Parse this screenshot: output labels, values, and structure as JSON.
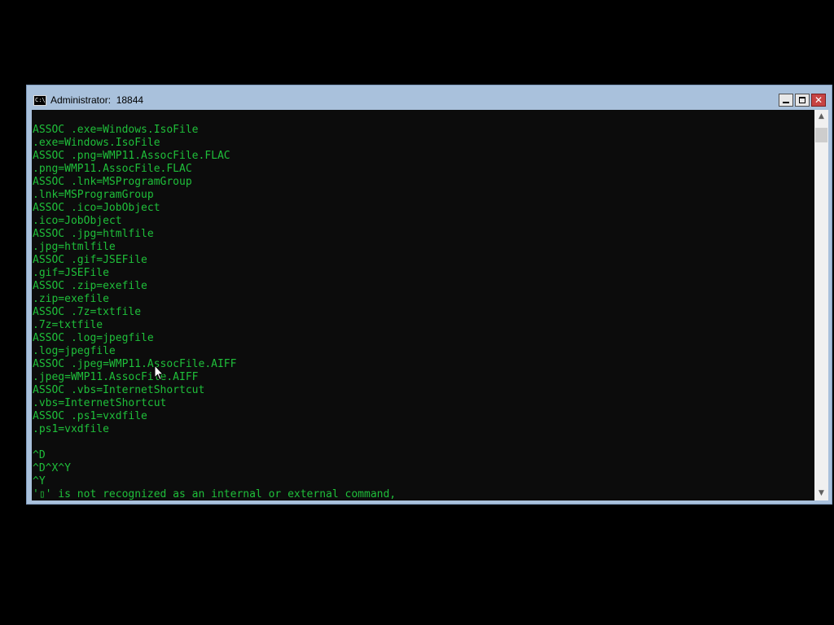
{
  "window": {
    "title": "Administrator:  18844",
    "icon": "cmd-app-icon",
    "icon_text": "C:\\"
  },
  "controls": {
    "minimize": "minimize-icon",
    "maximize": "maximize-icon",
    "close": "close-icon",
    "close_glyph": "✕"
  },
  "console": {
    "text_color": "#1fbf3a",
    "background": "#0c0c0c",
    "lines": [
      "ASSOC .exe=Windows.IsoFile",
      ".exe=Windows.IsoFile",
      "ASSOC .png=WMP11.AssocFile.FLAC",
      ".png=WMP11.AssocFile.FLAC",
      "ASSOC .lnk=MSProgramGroup",
      ".lnk=MSProgramGroup",
      "ASSOC .ico=JobObject",
      ".ico=JobObject",
      "ASSOC .jpg=htmlfile",
      ".jpg=htmlfile",
      "ASSOC .gif=JSEFile",
      ".gif=JSEFile",
      "ASSOC .zip=exefile",
      ".zip=exefile",
      "ASSOC .7z=txtfile",
      ".7z=txtfile",
      "ASSOC .log=jpegfile",
      ".log=jpegfile",
      "ASSOC .jpeg=WMP11.AssocFile.AIFF",
      ".jpeg=WMP11.AssocFile.AIFF",
      "ASSOC .vbs=InternetShortcut",
      ".vbs=InternetShortcut",
      "ASSOC .ps1=vxdfile",
      ".ps1=vxdfile",
      "",
      "^D",
      "^D^X^Y",
      "^Y",
      "'▯' is not recognized as an internal or external command,"
    ]
  },
  "scrollbar": {
    "up_glyph": "▲",
    "down_glyph": "▼"
  }
}
